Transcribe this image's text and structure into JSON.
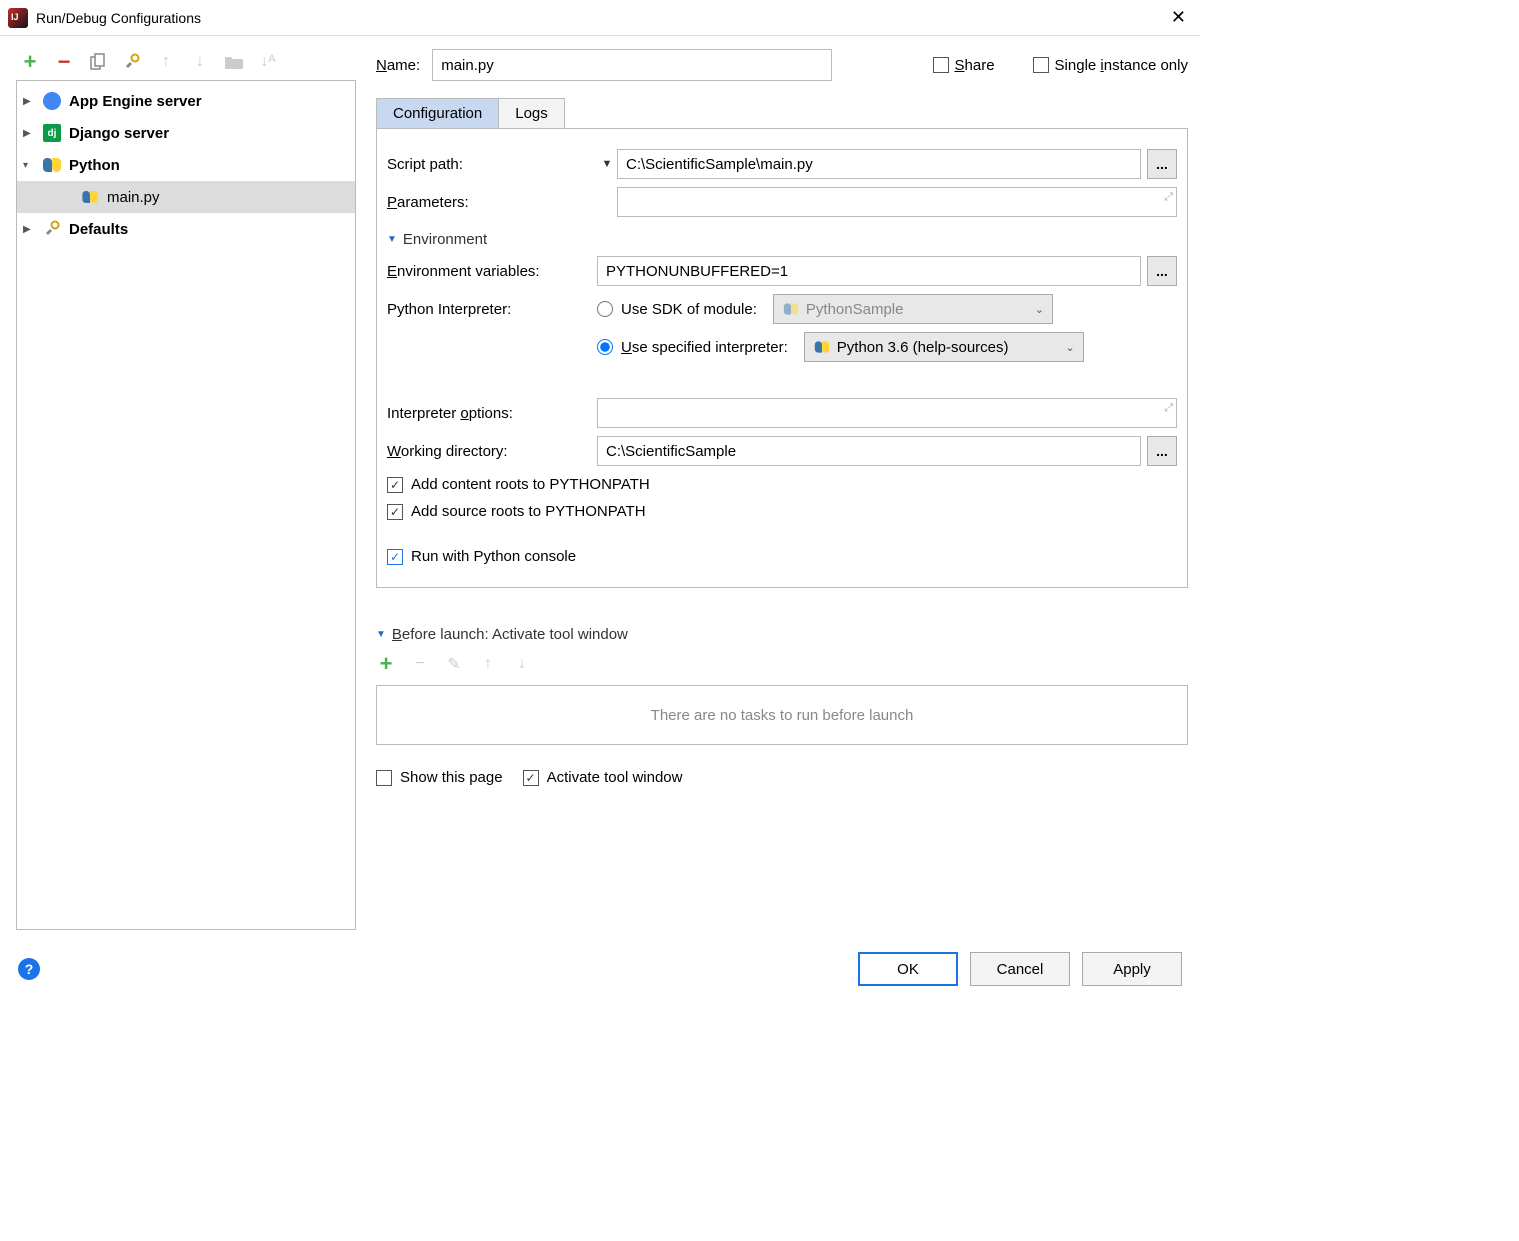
{
  "title": "Run/Debug Configurations",
  "sidebar": {
    "items": [
      {
        "label": "App Engine server",
        "expanded": false
      },
      {
        "label": "Django server",
        "expanded": false
      },
      {
        "label": "Python",
        "expanded": true,
        "children": [
          {
            "label": "main.py",
            "selected": true
          }
        ]
      },
      {
        "label": "Defaults",
        "expanded": false
      }
    ]
  },
  "name": {
    "label": "Name:",
    "value": "main.py"
  },
  "share": {
    "label": "Share"
  },
  "single_instance": {
    "label": "Single instance only"
  },
  "tabs": {
    "configuration": "Configuration",
    "logs": "Logs"
  },
  "config": {
    "script_path": {
      "label": "Script path:",
      "value": "C:\\ScientificSample\\main.py"
    },
    "parameters": {
      "label": "Parameters:",
      "value": ""
    },
    "environment_heading": "Environment",
    "env_vars": {
      "label": "Environment variables:",
      "value": "PYTHONUNBUFFERED=1"
    },
    "interpreter_label": "Python Interpreter:",
    "use_sdk": {
      "label": "Use SDK of module:",
      "value": "PythonSample"
    },
    "use_specified": {
      "label": "Use specified interpreter:",
      "value": "Python 3.6 (help-sources)"
    },
    "interp_options": {
      "label": "Interpreter options:",
      "value": ""
    },
    "working_dir": {
      "label": "Working directory:",
      "value": "C:\\ScientificSample"
    },
    "add_content_roots": "Add content roots to PYTHONPATH",
    "add_source_roots": "Add source roots to PYTHONPATH",
    "run_console": "Run with Python console"
  },
  "before_launch": {
    "heading": "Before launch: Activate tool window",
    "empty": "There are no tasks to run before launch",
    "show_this_page": "Show this page",
    "activate_tool_window": "Activate tool window"
  },
  "footer": {
    "ok": "OK",
    "cancel": "Cancel",
    "apply": "Apply"
  }
}
